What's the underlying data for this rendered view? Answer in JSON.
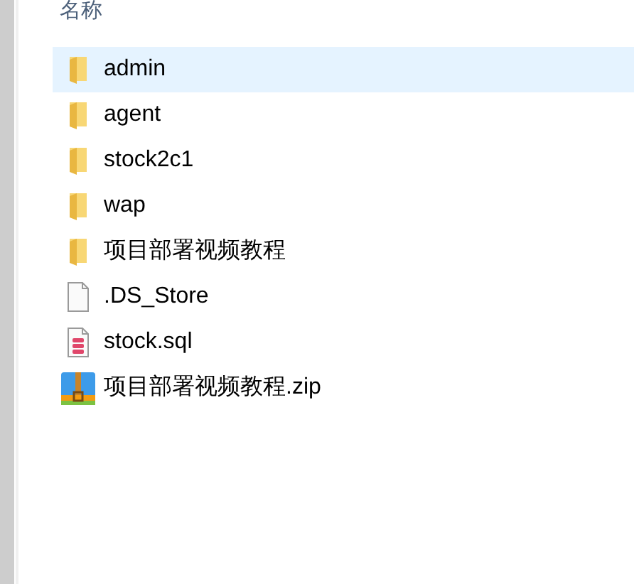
{
  "column_header": "名称",
  "files": [
    {
      "name": "admin",
      "kind": "folder",
      "selected": true
    },
    {
      "name": "agent",
      "kind": "folder",
      "selected": false
    },
    {
      "name": "stock2c1",
      "kind": "folder",
      "selected": false
    },
    {
      "name": "wap",
      "kind": "folder",
      "selected": false
    },
    {
      "name": "项目部署视频教程",
      "kind": "folder",
      "selected": false
    },
    {
      "name": ".DS_Store",
      "kind": "file",
      "selected": false
    },
    {
      "name": "stock.sql",
      "kind": "sql",
      "selected": false
    },
    {
      "name": "项目部署视频教程.zip",
      "kind": "zip",
      "selected": false
    }
  ]
}
